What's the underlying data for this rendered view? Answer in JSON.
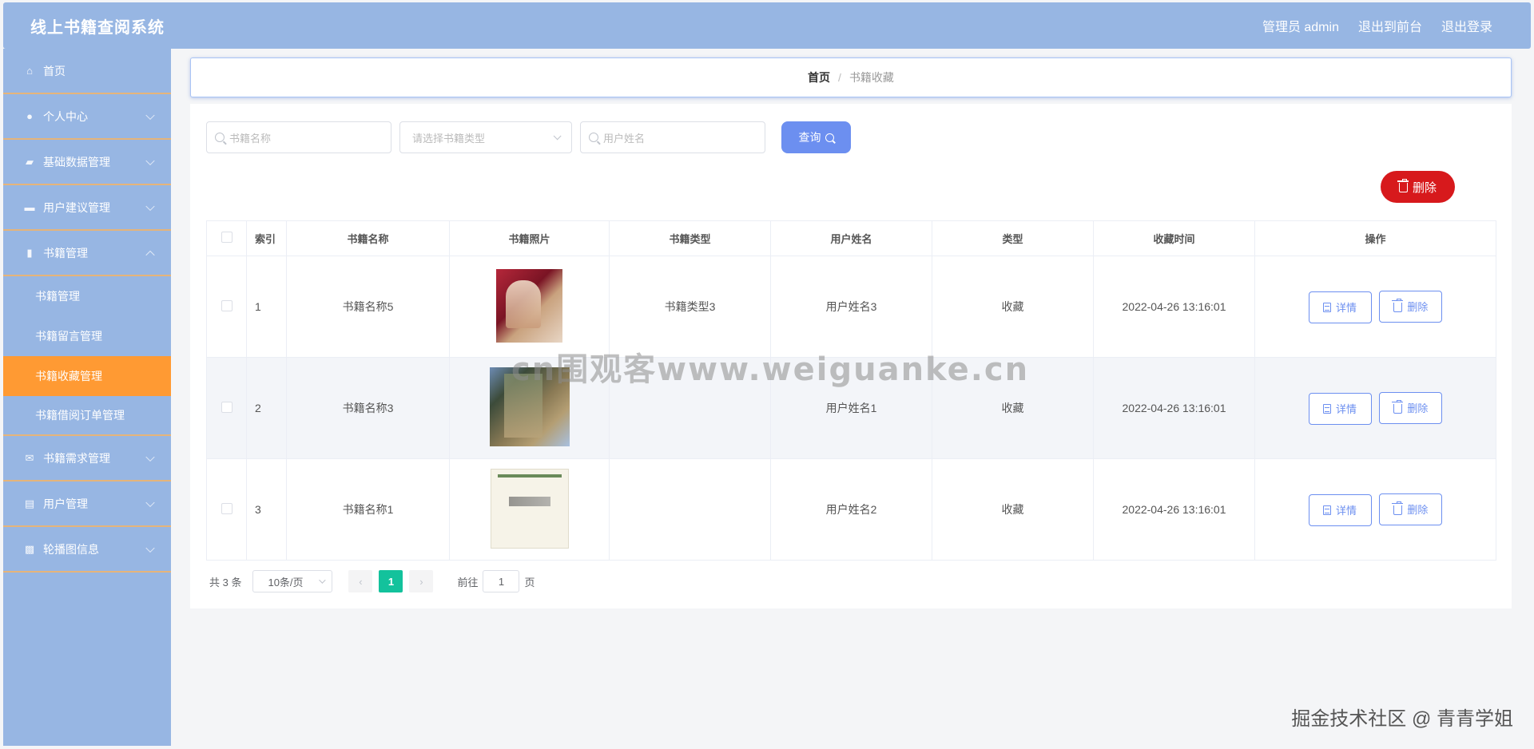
{
  "header": {
    "title": "线上书籍查阅系统",
    "admin_label": "管理员 admin",
    "front_link": "退出到前台",
    "logout_link": "退出登录"
  },
  "sidebar": {
    "items": [
      {
        "label": "首页",
        "icon": "home-icon",
        "chevron": false
      },
      {
        "label": "个人中心",
        "icon": "user-icon",
        "chevron": true
      },
      {
        "label": "基础数据管理",
        "icon": "folder-icon",
        "chevron": true
      },
      {
        "label": "用户建议管理",
        "icon": "briefcase-icon",
        "chevron": true
      },
      {
        "label": "书籍管理",
        "icon": "mic-icon",
        "chevron": true,
        "expanded": true
      }
    ],
    "subitems": [
      {
        "label": "书籍管理",
        "active": false
      },
      {
        "label": "书籍留言管理",
        "active": false
      },
      {
        "label": "书籍收藏管理",
        "active": true
      },
      {
        "label": "书籍借阅订单管理",
        "active": false
      }
    ],
    "items_after": [
      {
        "label": "书籍需求管理",
        "icon": "mail-icon",
        "chevron": true
      },
      {
        "label": "用户管理",
        "icon": "clipboard-icon",
        "chevron": true
      },
      {
        "label": "轮播图信息",
        "icon": "ticket-icon",
        "chevron": true
      }
    ]
  },
  "breadcrumb": {
    "home": "首页",
    "separator": "/",
    "current": "书籍收藏"
  },
  "search": {
    "book_name_placeholder": "书籍名称",
    "book_type_placeholder": "请选择书籍类型",
    "user_name_placeholder": "用户姓名",
    "query_label": "查询"
  },
  "toolbar": {
    "delete_label": "删除"
  },
  "table": {
    "columns": [
      "索引",
      "书籍名称",
      "书籍照片",
      "书籍类型",
      "用户姓名",
      "类型",
      "收藏时间",
      "操作"
    ],
    "rows": [
      {
        "index": "1",
        "book_name": "书籍名称5",
        "book_type": "书籍类型3",
        "user_name": "用户姓名3",
        "type": "收藏",
        "time": "2022-04-26 13:16:01"
      },
      {
        "index": "2",
        "book_name": "书籍名称3",
        "book_type": "",
        "user_name": "用户姓名1",
        "type": "收藏",
        "time": "2022-04-26 13:16:01"
      },
      {
        "index": "3",
        "book_name": "书籍名称1",
        "book_type": "",
        "user_name": "用户姓名2",
        "type": "收藏",
        "time": "2022-04-26 13:16:01"
      }
    ],
    "detail_label": "详情",
    "delete_label": "删除"
  },
  "pagination": {
    "total": "共 3 条",
    "page_size": "10条/页",
    "prev": "‹",
    "current_page": "1",
    "next": "›",
    "goto_label": "前往",
    "goto_value": "1",
    "page_suffix": "页"
  },
  "watermarks": {
    "center": "cn围观客www.weiguanke.cn",
    "corner": "掘金技术社区 @ 青青学姐"
  },
  "colors": {
    "header_bg": "#97b6e3",
    "active_menu": "#ff9a33",
    "primary": "#6c8ff0",
    "danger": "#d7191c",
    "page_active": "#13c29c"
  }
}
